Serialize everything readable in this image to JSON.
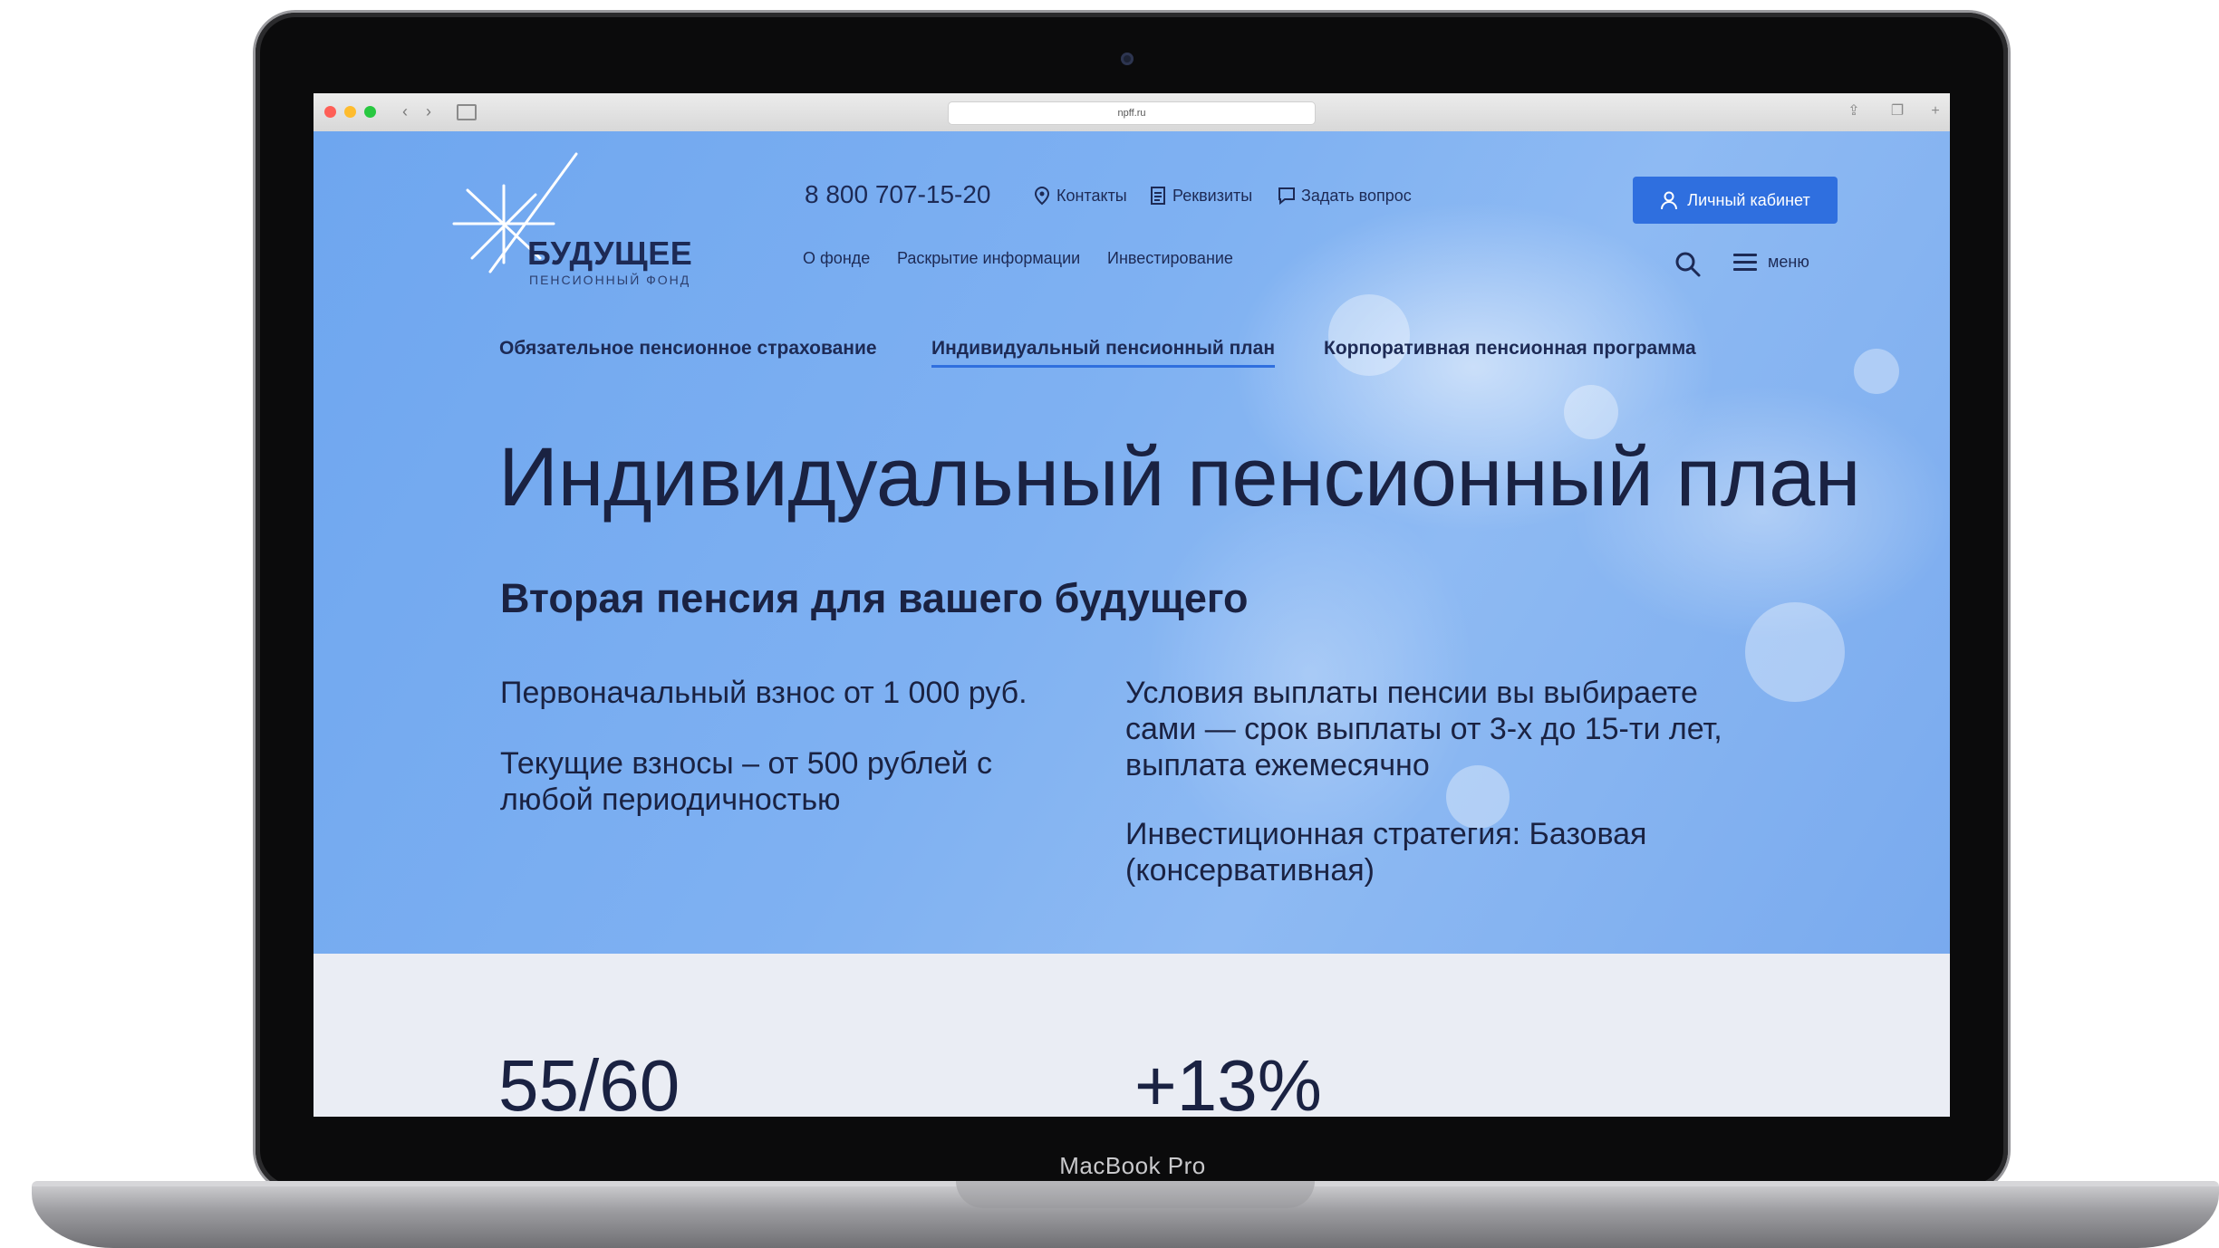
{
  "device": {
    "label": "MacBook Pro"
  },
  "browser": {
    "address": "npff.ru"
  },
  "header": {
    "logo": {
      "name": "БУДУЩЕЕ",
      "subtitle": "ПЕНСИОННЫЙ ФОНД"
    },
    "phone": "8 800 707-15-20",
    "top_links": [
      "Контакты",
      "Реквизиты",
      "Задать вопрос"
    ],
    "main_links": [
      "О фонде",
      "Раскрытие информации",
      "Инвестирование"
    ],
    "cabinet_label": "Личный кабинет",
    "menu_label": "меню",
    "accent_color": "#2f6fdf"
  },
  "subnav": {
    "items": [
      "Обязательное пенсионное страхование",
      "Индивидуальный пенсионный план",
      "Корпоративная пенсионная программа"
    ],
    "active_index": 1
  },
  "hero": {
    "title": "Индивидуальный пенсионный план",
    "subtitle": "Вторая пенсия для вашего будущего",
    "left": [
      "Первоначальный взнос от 1 000 руб.",
      "Текущие взносы – от 500 рублей с любой периодичностью"
    ],
    "right": [
      "Условия выплаты пенсии вы выбираете сами — срок выплаты от 3-х до 15-ти лет, выплата ежемесячно",
      "Инвестиционная стратегия: Базовая (консервативная)"
    ]
  },
  "stats": [
    "55/60",
    "+13%"
  ]
}
